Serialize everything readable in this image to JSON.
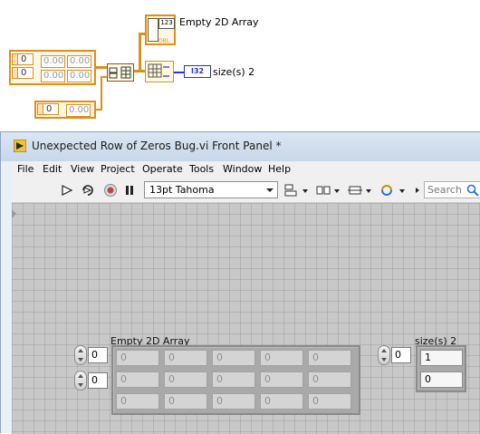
{
  "diagram": {
    "constant_index_1": "0",
    "constant_index_2": "0",
    "constant_cells": [
      "0.00",
      "0.00",
      "0.00",
      "0.00"
    ],
    "single_index": "0",
    "single_cell": "0.00",
    "indicator_type": "DBL",
    "indicator_label": "Empty 2D Array",
    "size_indicator_type": "I32",
    "size_label": "size(s) 2"
  },
  "window": {
    "title": "Unexpected Row of Zeros Bug.vi Front Panel *"
  },
  "menu": [
    "File",
    "Edit",
    "View",
    "Project",
    "Operate",
    "Tools",
    "Window",
    "Help"
  ],
  "toolbar": {
    "font": "13pt Tahoma",
    "search_placeholder": "Search"
  },
  "panel": {
    "array_label": "Empty 2D Array",
    "array_index_row": "0",
    "array_index_col": "0",
    "array_cells": [
      [
        "0",
        "0",
        "0",
        "0",
        "0"
      ],
      [
        "0",
        "0",
        "0",
        "0",
        "0"
      ],
      [
        "0",
        "0",
        "0",
        "0",
        "0"
      ]
    ],
    "size_label": "size(s) 2",
    "size_index": "0",
    "size_values": [
      "1",
      "0"
    ]
  },
  "colors": {
    "wire_orange": "#e08f1a",
    "wire_blue": "#2a34c8",
    "canvas_grey": "#c8c8c8"
  }
}
